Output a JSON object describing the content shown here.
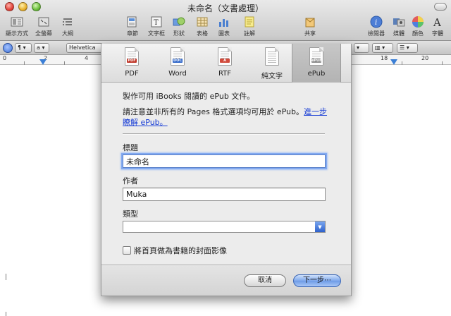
{
  "window": {
    "title": "未命名（文書處理）"
  },
  "toolbar": {
    "items": [
      {
        "label": "顯示方式",
        "icon": "view-icon"
      },
      {
        "label": "全螢幕",
        "icon": "fullscreen-icon"
      },
      {
        "label": "大綱",
        "icon": "outline-icon"
      },
      {
        "label": "章節",
        "icon": "sections-icon"
      },
      {
        "label": "文字框",
        "icon": "textbox-icon"
      },
      {
        "label": "形狀",
        "icon": "shapes-icon"
      },
      {
        "label": "表格",
        "icon": "table-icon"
      },
      {
        "label": "圖表",
        "icon": "chart-icon"
      },
      {
        "label": "註解",
        "icon": "comment-icon"
      },
      {
        "label": "共享",
        "icon": "share-icon"
      },
      {
        "label": "檢閱器",
        "icon": "inspector-icon"
      },
      {
        "label": "媒體",
        "icon": "media-icon"
      },
      {
        "label": "顏色",
        "icon": "colors-icon"
      },
      {
        "label": "字體",
        "icon": "fonts-icon"
      }
    ]
  },
  "formatbar": {
    "style_symbol": "¶",
    "char_style": "a",
    "font_name": "Helvetica"
  },
  "ruler": {
    "numbers": [
      "0",
      "2",
      "4",
      "18",
      "20"
    ]
  },
  "sheet": {
    "formats": [
      {
        "label": "PDF",
        "chip": "PDF",
        "chip_color": "#c0392b"
      },
      {
        "label": "Word",
        "chip": "DOC",
        "chip_color": "#2f66c8"
      },
      {
        "label": "RTF",
        "chip": "A",
        "chip_color": "#d14b3c"
      },
      {
        "label": "純文字",
        "chip": "",
        "chip_color": "#888888"
      },
      {
        "label": "ePub",
        "chip": "ePUB",
        "chip_color": "#8e8e8e"
      }
    ],
    "selected_format": "ePub",
    "intro": "製作可用 iBooks 閱讀的 ePub 文件。",
    "note_text": "請注意並非所有的 Pages 格式選項均可用於 ePub。",
    "note_link": "進一步瞭解 ePub。",
    "title_label": "標題",
    "title_value": "未命名",
    "author_label": "作者",
    "author_value": "Muka",
    "genre_label": "類型",
    "genre_value": "",
    "cover_checkbox_label": "將首頁做為書籍的封面影像",
    "cover_checked": false,
    "cancel_label": "取消",
    "next_label": "下一步⋯"
  }
}
